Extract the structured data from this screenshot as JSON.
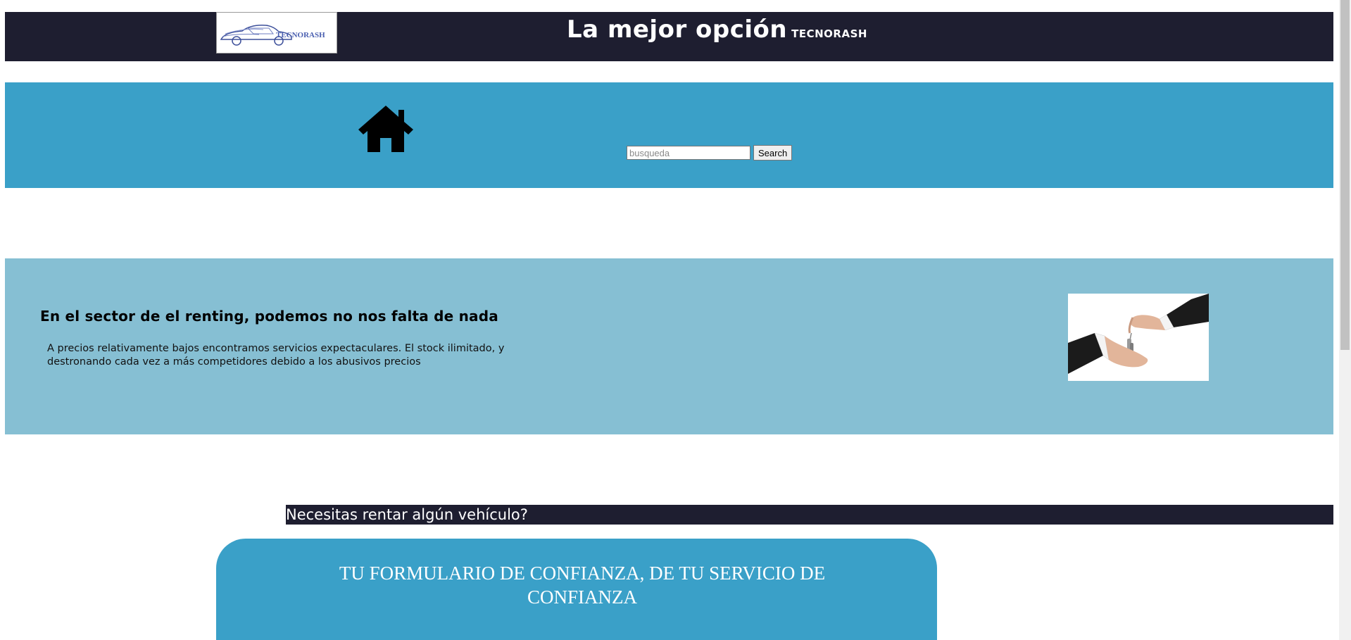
{
  "header": {
    "logo_text": "TECNORASH",
    "title": "La mejor opción",
    "brand_small": "TECNORASH"
  },
  "nav": {
    "home_icon": "home-icon",
    "search": {
      "placeholder": "busqueda",
      "value": "",
      "button_label": "Search"
    }
  },
  "hero": {
    "heading": "En el sector de el renting, podemos no nos falta de nada",
    "text": "A precios relativamente bajos encontramos servicios expectaculares. El stock ilimitado, y destronando cada vez a más competidores debido a los abusivos precios",
    "image": "handing-over-keys-photo"
  },
  "rent_banner": {
    "text": "Necesitas rentar algún vehículo?"
  },
  "form_card": {
    "title": "TU FORMULARIO DE CONFIANZA, DE TU SERVICIO DE CONFIANZA"
  },
  "colors": {
    "header_bg": "#1e1e30",
    "nav_bg": "#3aa0c8",
    "hero_bg": "#86bfd3",
    "card_bg": "#3aa0c8"
  }
}
